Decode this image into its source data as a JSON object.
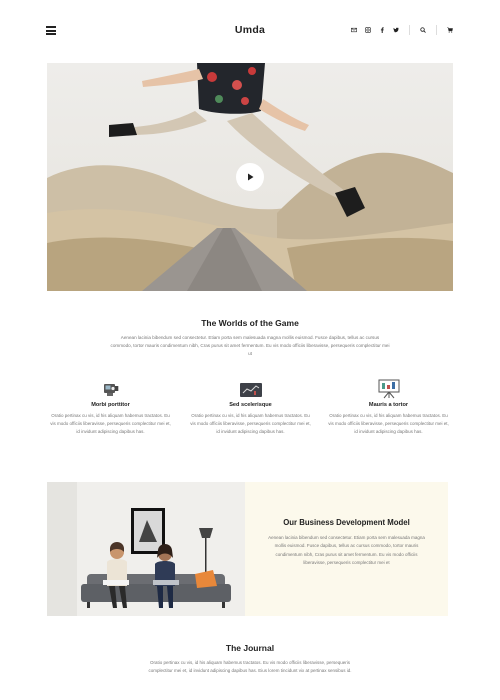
{
  "header": {
    "logo": "Umda",
    "menu_icon": "hamburger-menu-icon",
    "social_icons": [
      "envelope-icon",
      "instagram-icon",
      "facebook-icon",
      "twitter-icon"
    ],
    "search_icon": "search-icon",
    "cart_icon": "cart-icon"
  },
  "hero": {
    "play_icon": "play-icon"
  },
  "worlds": {
    "title": "The Worlds of the Game",
    "text": "Aenean lacinia bibendum sed consectetur. Etiam porta sem malesuada magna mollis euismod. Fusce dapibus, tellus ac cursus commodo, tortor mauris condimentum nibh, Cras purus sit amet fermentum. Eu vis modo officiis liberavisse, persequeris complectitur mei ut"
  },
  "features": [
    {
      "icon": "camcorder-icon",
      "title": "Morbi porttitor",
      "text": "Oratio pertinax cu vis, id his aliquam habemus tractatos. Eu vis modo officiis liberavisse, persequeris complectitur mei et, id invidunt adipiscing dapibus has."
    },
    {
      "icon": "chart-board-icon",
      "title": "Sed scelerisque",
      "text": "Oratio pertinax cu vis, id his aliquam habemus tractatos. Eu vis modo officiis liberavisse, persequeris complectitur mei et, id invidunt adipiscing dapibus has."
    },
    {
      "icon": "presentation-board-icon",
      "title": "Mauris a tortor",
      "text": "Oratio pertinax cu vis, id his aliquam habemus tractatos. Eu vis modo officiis liberavisse, persequeris complectitur mei et, id invidunt adipiscing dapibus has."
    }
  ],
  "business": {
    "title": "Our Business Development Model",
    "text": "Aenean lacinia bibendum sed consectetur. Etiam porta sem malesuada magna mollis euismod. Fusce dapibus, tellus ac cursus commodo, tortor mauris condimentum nibh, Cras purus sit amet fermentum. Eu vis modo officiis liberavisse, persequeris complectitur mei et"
  },
  "journal": {
    "title": "The Journal",
    "text": "Oratio pertinax cu vis, id his aliquam habemus tractatos. Eu vis modo officiis liberavisse, persequeris complectitur mei et, id invidunt adipiscing dapibus has. Eius lorem tincidunt vix at pertinax sensibus id."
  },
  "colors": {
    "accent_background": "#fcf9ec",
    "text_dark": "#222222",
    "text_muted": "#777777"
  }
}
